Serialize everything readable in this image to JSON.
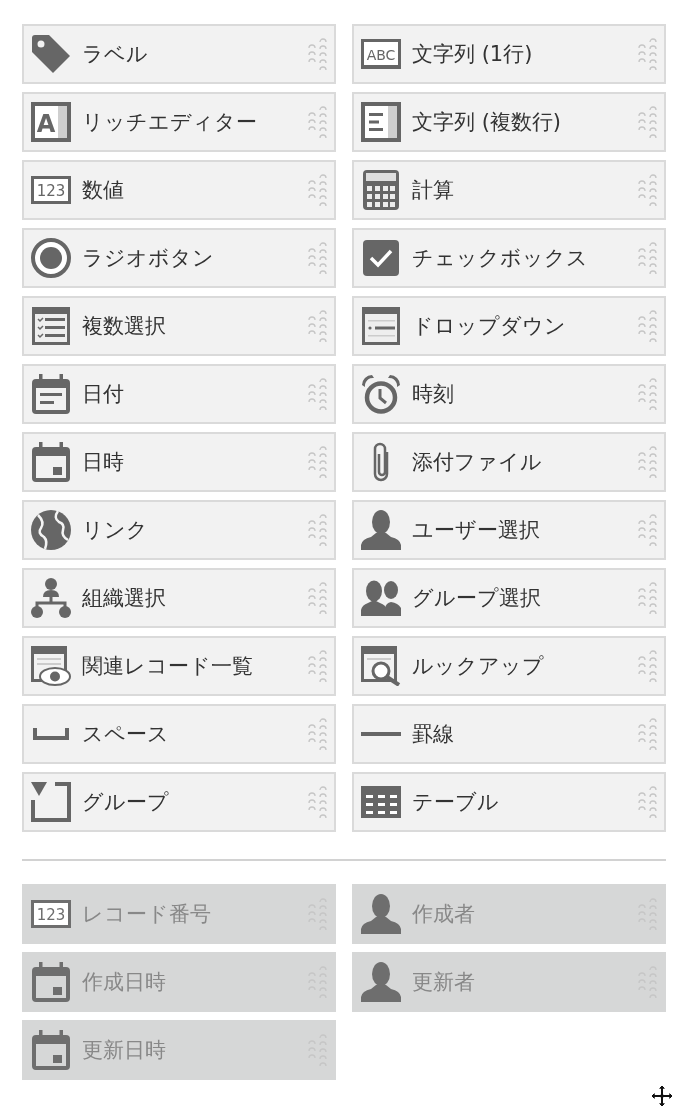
{
  "field_palette": {
    "items": [
      {
        "kind": "label",
        "label": "ラベル",
        "disabled": false
      },
      {
        "kind": "single_line_text",
        "label": "文字列 (1行)",
        "icon_text": "ABC",
        "disabled": false
      },
      {
        "kind": "rich_text",
        "label": "リッチエディター",
        "icon_text": "A",
        "disabled": false
      },
      {
        "kind": "multi_line_text",
        "label": "文字列 (複数行)",
        "disabled": false
      },
      {
        "kind": "number",
        "label": "数値",
        "icon_text": "123",
        "disabled": false
      },
      {
        "kind": "calc",
        "label": "計算",
        "disabled": false
      },
      {
        "kind": "radio",
        "label": "ラジオボタン",
        "disabled": false
      },
      {
        "kind": "checkbox",
        "label": "チェックボックス",
        "disabled": false
      },
      {
        "kind": "multi_select",
        "label": "複数選択",
        "disabled": false
      },
      {
        "kind": "dropdown",
        "label": "ドロップダウン",
        "disabled": false
      },
      {
        "kind": "date",
        "label": "日付",
        "disabled": false
      },
      {
        "kind": "time",
        "label": "時刻",
        "disabled": false
      },
      {
        "kind": "datetime",
        "label": "日時",
        "disabled": false
      },
      {
        "kind": "file",
        "label": "添付ファイル",
        "disabled": false
      },
      {
        "kind": "link",
        "label": "リンク",
        "disabled": false
      },
      {
        "kind": "user",
        "label": "ユーザー選択",
        "disabled": false
      },
      {
        "kind": "org",
        "label": "組織選択",
        "disabled": false
      },
      {
        "kind": "group_select",
        "label": "グループ選択",
        "disabled": false
      },
      {
        "kind": "related_records",
        "label": "関連レコード一覧",
        "disabled": false
      },
      {
        "kind": "lookup",
        "label": "ルックアップ",
        "disabled": false
      },
      {
        "kind": "spacer",
        "label": "スペース",
        "disabled": false
      },
      {
        "kind": "hr",
        "label": "罫線",
        "disabled": false
      },
      {
        "kind": "group",
        "label": "グループ",
        "disabled": false
      },
      {
        "kind": "table",
        "label": "テーブル",
        "disabled": false
      }
    ]
  },
  "system_fields": {
    "items": [
      {
        "kind": "number",
        "label": "レコード番号",
        "icon_text": "123",
        "disabled": true
      },
      {
        "kind": "user",
        "label": "作成者",
        "disabled": true
      },
      {
        "kind": "datetime",
        "label": "作成日時",
        "disabled": true
      },
      {
        "kind": "user",
        "label": "更新者",
        "disabled": true
      },
      {
        "kind": "datetime",
        "label": "更新日時",
        "disabled": true
      }
    ]
  }
}
